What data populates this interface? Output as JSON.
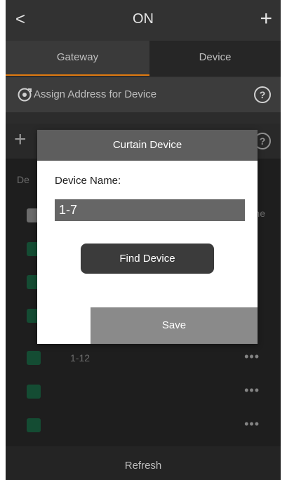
{
  "topbar": {
    "back": "<",
    "title": "ON",
    "add": "+"
  },
  "tabs": {
    "gateway": "Gateway",
    "device": "Device"
  },
  "assign_row": {
    "label": "Assign Address for Device",
    "help": "?"
  },
  "add_row": {
    "add": "+",
    "help": "?"
  },
  "list": {
    "header_partial": "De",
    "right_partial": "ne",
    "rows": [
      {
        "name": "1-12",
        "more": "•••"
      },
      {
        "name": "",
        "more": "•••"
      },
      {
        "name": "",
        "more": "•••"
      }
    ]
  },
  "dialog": {
    "title": "Curtain Device",
    "name_label": "Device Name:",
    "name_value": "1-7",
    "find_label": "Find Device",
    "save_label": "Save"
  },
  "footer": {
    "refresh": "Refresh"
  },
  "colors": {
    "accent": "#e07a10",
    "device_icon": "#1e6e4a"
  }
}
